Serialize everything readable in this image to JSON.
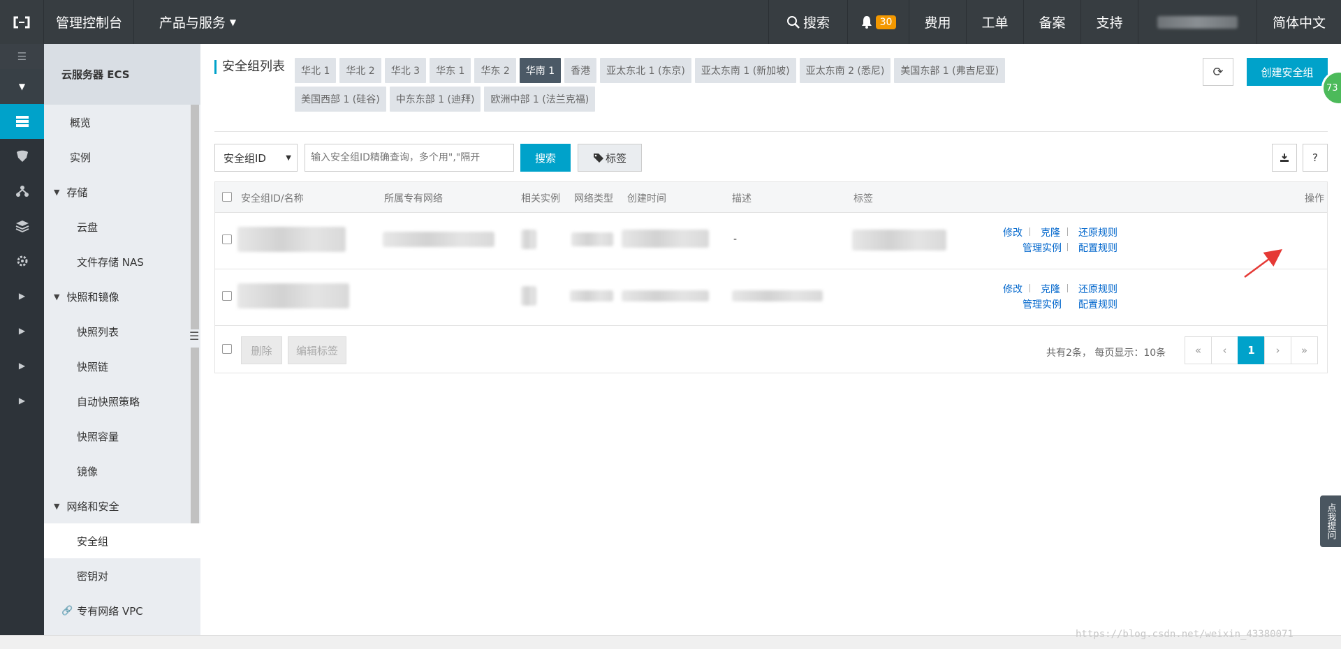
{
  "topbar": {
    "logo": "[-]",
    "console": "管理控制台",
    "products": "产品与服务",
    "search": "搜索",
    "notifications_count": "30",
    "fee": "费用",
    "ticket": "工单",
    "beian": "备案",
    "support": "支持",
    "language": "简体中文"
  },
  "sidebar": {
    "header": "云服务器 ECS",
    "items": [
      {
        "label": "概览"
      },
      {
        "label": "实例"
      },
      {
        "label": "存储"
      },
      {
        "label": "云盘"
      },
      {
        "label": "文件存储 NAS"
      },
      {
        "label": "快照和镜像"
      },
      {
        "label": "快照列表"
      },
      {
        "label": "快照链"
      },
      {
        "label": "自动快照策略"
      },
      {
        "label": "快照容量"
      },
      {
        "label": "镜像"
      },
      {
        "label": "网络和安全"
      },
      {
        "label": "安全组"
      },
      {
        "label": "密钥对"
      },
      {
        "label": "专有网络 VPC"
      }
    ],
    "active": "安全组"
  },
  "page": {
    "title": "安全组列表",
    "regions": [
      "华北 1",
      "华北 2",
      "华北 3",
      "华东 1",
      "华东 2",
      "华南 1",
      "香港",
      "亚太东北 1 (东京)",
      "亚太东南 1 (新加坡)",
      "亚太东南 2 (悉尼)",
      "美国东部 1 (弗吉尼亚)",
      "美国西部 1 (硅谷)",
      "中东东部 1 (迪拜)",
      "欧洲中部 1 (法兰克福)"
    ],
    "selected_region": "华南 1",
    "create_button": "创建安全组",
    "floating_badge": "73"
  },
  "filter": {
    "type_select": "安全组ID",
    "search_placeholder": "输入安全组ID精确查询，多个用\",\"隔开",
    "search_button": "搜索",
    "tag_button": "标签",
    "help_button": "?"
  },
  "table": {
    "columns": [
      "安全组ID/名称",
      "所属专有网络",
      "相关实例",
      "网络类型",
      "创建时间",
      "描述",
      "标签",
      "操作"
    ],
    "rows": [
      {
        "description": "-",
        "actions": [
          "修改",
          "克隆",
          "还原规则",
          "管理实例",
          "配置规则"
        ]
      },
      {
        "description": "",
        "actions": [
          "修改",
          "克隆",
          "还原规则",
          "管理实例",
          "配置规则"
        ]
      }
    ]
  },
  "footer": {
    "delete_button": "删除",
    "edit_tags_button": "编辑标签",
    "pagination_info": "共有2条， 每页显示：10条",
    "pager": [
      "«",
      "‹",
      "1",
      "›",
      "»"
    ],
    "current_page": "1"
  },
  "feedback_tab": "点我提问",
  "watermark": "https://blog.csdn.net/weixin_43380071",
  "colors": {
    "accent": "#00a2ca",
    "topbar": "#373d41",
    "link": "#0066cc",
    "arrow": "#e53935"
  }
}
